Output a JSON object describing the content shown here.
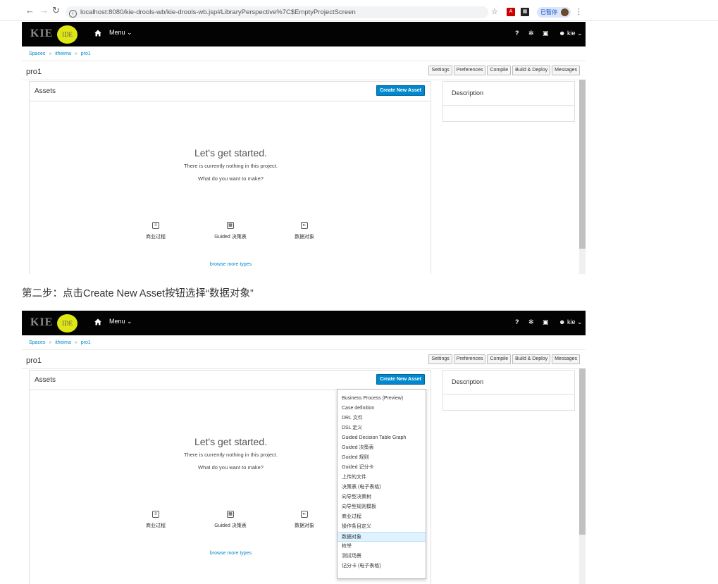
{
  "browser": {
    "url": "localhost:8080/kie-drools-wb/kie-drools-wb.jsp#LibraryPerspective%7C$EmptyProjectScreen",
    "paused_label": "已暂停"
  },
  "app": {
    "logo_text": "KIE",
    "badge_text": "IDE",
    "menu_label": "Menu",
    "help_label": "?",
    "user_label": "kie",
    "breadcrumbs": [
      "Spaces",
      "itheima",
      "pro1"
    ],
    "project_title": "pro1",
    "toolbar": [
      "Settings",
      "Preferences",
      "Compile",
      "Build & Deploy",
      "Messages"
    ],
    "assets_title": "Assets",
    "create_button": "Create New Asset",
    "empty_title": "Let's get started.",
    "empty_sub": "There is currently nothing in this project.",
    "empty_question": "What do you want to make?",
    "asset_types": [
      "商业过程",
      "Guided 决策表",
      "数据对象"
    ],
    "browse_more": "browse more types",
    "description_title": "Description"
  },
  "caption": "第二步：点击Create New Asset按钮选择“数据对象”",
  "dropdown": {
    "items": [
      "Business Process (Preview)",
      "Case definition",
      "DRL 文件",
      "DSL 定义",
      "Guided Decision Table Graph",
      "Guided 决策表",
      "Guided 规则",
      "Guided 记分卡",
      "上传的文件",
      "决策表 (电子表格)",
      "向导型决策树",
      "向导型规则模板",
      "商业过程",
      "操作条目定义",
      "数据对象",
      "枚举",
      "测试场景",
      "记分卡 (电子表格)"
    ],
    "selected": "数据对象"
  },
  "colors": {
    "topbar": "#030303",
    "badge": "#dfe616",
    "primary_button": "#0088ce",
    "link": "#0088ce",
    "selected_item": "#def3ff"
  }
}
